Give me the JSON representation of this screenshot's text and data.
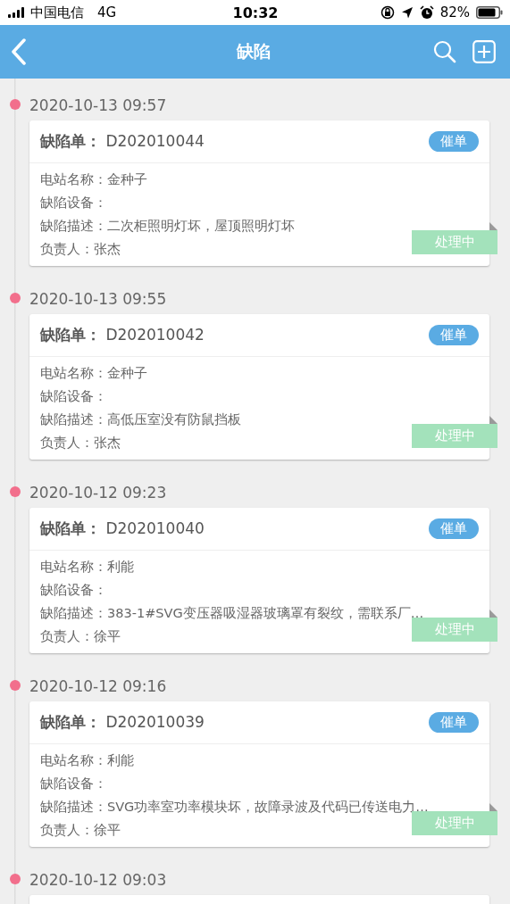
{
  "status_bar": {
    "carrier": "中国电信",
    "network": "4G",
    "time": "10:32",
    "battery": "82%"
  },
  "header": {
    "title": "缺陷"
  },
  "defects": [
    {
      "time": "2020-10-13 09:57",
      "order": "**缺陷单：** D202010044",
      "urge_button": "催单",
      "fields": [
        "电站名称：金种子",
        "缺陷设备：",
        "缺陷描述：二次柜照明灯坏，屋顶照明灯坏",
        "负责人：张杰"
      ],
      "status": "处理中"
    },
    {
      "time": "2020-10-13 09:55",
      "order": "**缺陷单：** D202010042",
      "urge_button": "催单",
      "fields": [
        "电站名称：金种子",
        "缺陷设备：",
        "缺陷描述：高低压室没有防鼠挡板",
        "负责人：张杰"
      ],
      "status": "处理中"
    },
    {
      "time": "2020-10-12 09:23",
      "order": "**缺陷单：** D202010040",
      "urge_button": "催单",
      "fields": [
        "电站名称：利能",
        "缺陷设备：",
        "缺陷描述：383-1#SVG变压器吸湿器玻璃罩有裂纹，需联系厂…",
        "负责人：徐平"
      ],
      "status": "处理中"
    },
    {
      "time": "2020-10-12 09:16",
      "order": "**缺陷单：** D202010039",
      "urge_button": "催单",
      "fields": [
        "电站名称：利能",
        "缺陷设备：",
        "缺陷描述：SVG功率室功率模块坏，故障录波及代码已传送电力…",
        "负责人：徐平"
      ],
      "status": "处理中"
    },
    {
      "time": "2020-10-12 09:03"
    }
  ]
}
